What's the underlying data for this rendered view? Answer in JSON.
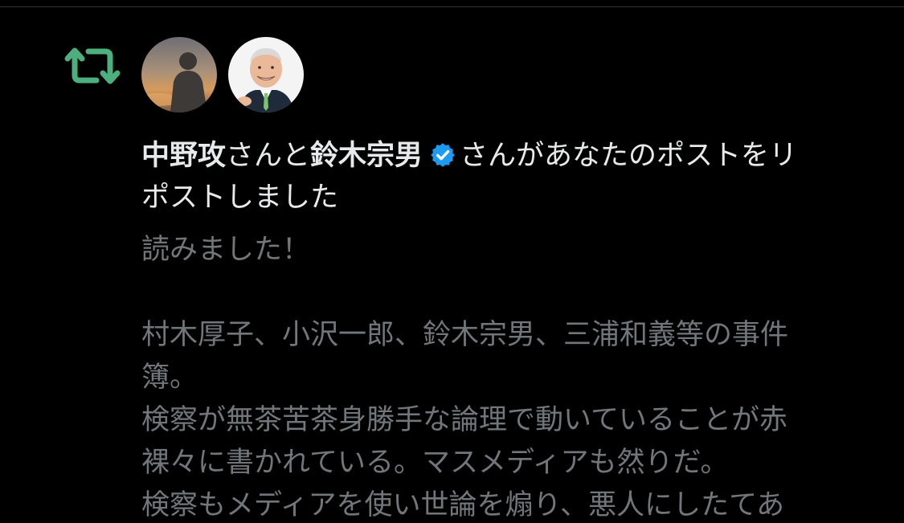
{
  "notification": {
    "type_icon": "repost-icon",
    "avatars": [
      {
        "icon": "avatar-person-sunset"
      },
      {
        "icon": "avatar-smiling-man-suit"
      }
    ],
    "user1_name": "中野攻",
    "joiner": "さんと",
    "user2_name": "鈴木宗男",
    "verified_icon": "verified-badge-icon",
    "action_line1": "さんがあなたのポストをリ",
    "action_line2": "ポストしました"
  },
  "post": {
    "lines": [
      "読みました！",
      "",
      "村木厚子、小沢一郎、鈴木宗男、三浦和義等の事件",
      "簿。",
      "検察が無茶苦茶身勝手な論理で動いていることが赤",
      "裸々に書かれている。マスメディアも然りだ。",
      "検察もメディアを使い世論を煽り、悪人にしたてあ"
    ]
  },
  "colors": {
    "background": "#000000",
    "repost_green": "#4caf7d",
    "verified_blue": "#1d9bf0",
    "primary_text": "#e7e9ea",
    "secondary_text": "#71767b"
  }
}
